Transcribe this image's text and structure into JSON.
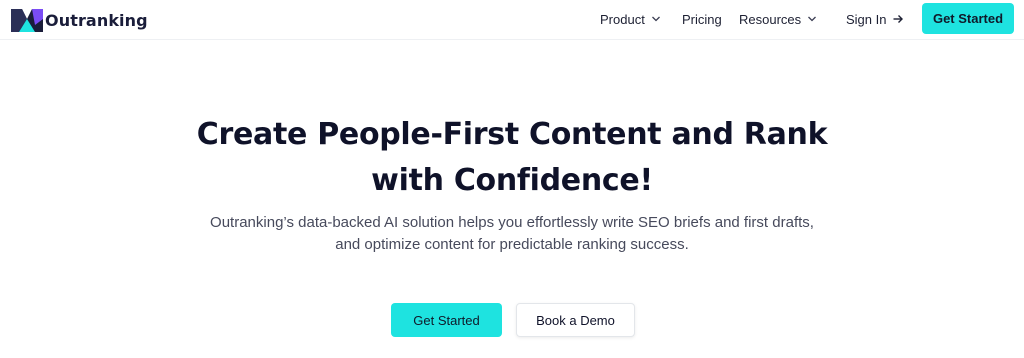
{
  "brand": {
    "name": "Outranking",
    "primary_color": "#1ee3e0",
    "logo_dark": "#1a1d3a",
    "logo_accent": "#7a4cf5"
  },
  "nav": {
    "items": [
      {
        "label": "Product",
        "icon": "chevron-down-icon"
      },
      {
        "label": "Pricing"
      },
      {
        "label": "Resources",
        "icon": "chevron-down-icon"
      }
    ],
    "sign_in": {
      "label": "Sign In",
      "icon": "arrow-right-icon"
    },
    "cta": {
      "label": "Get Started"
    }
  },
  "hero": {
    "title_line1": "Create People-First Content and Rank",
    "title_line2": "with Confidence!",
    "subtitle_line1": "Outranking’s data-backed AI solution helps you effortlessly write SEO briefs and first drafts,",
    "subtitle_line2": "and optimize content for predictable ranking success.",
    "primary_button": "Get Started",
    "secondary_button": "Book a Demo"
  }
}
